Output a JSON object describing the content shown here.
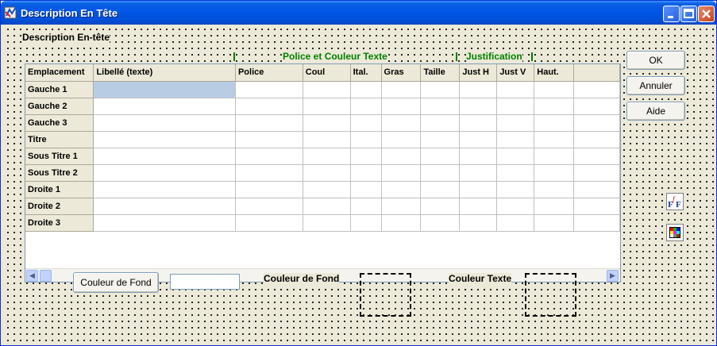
{
  "window": {
    "title": "Description En Tête"
  },
  "form": {
    "heading": "Description En-tête",
    "group_font_color": "Police et Couleur Texte",
    "group_justification": "Justification"
  },
  "buttons": {
    "ok": "OK",
    "cancel": "Annuler",
    "help": "Aide",
    "bg_color": "Couleur de Fond"
  },
  "grid": {
    "columns": [
      "Emplacement",
      "Libellé (texte)",
      "Police",
      "Coul",
      "Ital.",
      "Gras",
      "Taille",
      "Just H",
      "Just V",
      "Haut."
    ],
    "rows": [
      "Gauche 1",
      "Gauche 2",
      "Gauche 3",
      "Titre",
      "Sous Titre 1",
      "Sous Titre 2",
      "Droite 1",
      "Droite 2",
      "Droite 3"
    ]
  },
  "color_labels": {
    "background": "Couleur de Fond",
    "text": "Couleur Texte"
  },
  "colors": {
    "titlebar": "#0054e3",
    "group_label": "#008000",
    "selected_cell": "#b8cce4"
  },
  "icons": {
    "font": "font-icon",
    "palette": "color-palette-icon"
  }
}
